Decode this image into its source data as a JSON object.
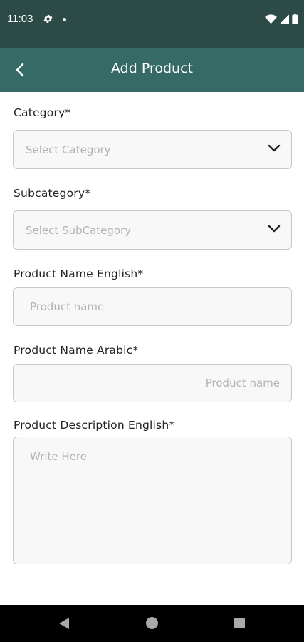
{
  "status_bar": {
    "time": "11:03",
    "icons": [
      "gear-icon",
      "notification-dot-icon",
      "wifi-icon",
      "signal-icon",
      "battery-icon"
    ]
  },
  "header": {
    "title": "Add Product",
    "back_icon": "chevron-left-icon",
    "background": "#356a66"
  },
  "form": {
    "category": {
      "label": "Category*",
      "placeholder": "Select Category"
    },
    "subcategory": {
      "label": "Subcategory*",
      "placeholder": "Select SubCategory"
    },
    "name_english": {
      "label": "Product Name English*",
      "placeholder": "Product name"
    },
    "name_arabic": {
      "label": "Product Name Arabic*",
      "placeholder": "Product name"
    },
    "description_english": {
      "label": "Product Description English*",
      "placeholder": "Write Here"
    }
  },
  "nav_bar": {
    "icons": [
      "back-triangle-icon",
      "home-circle-icon",
      "recents-square-icon"
    ]
  }
}
